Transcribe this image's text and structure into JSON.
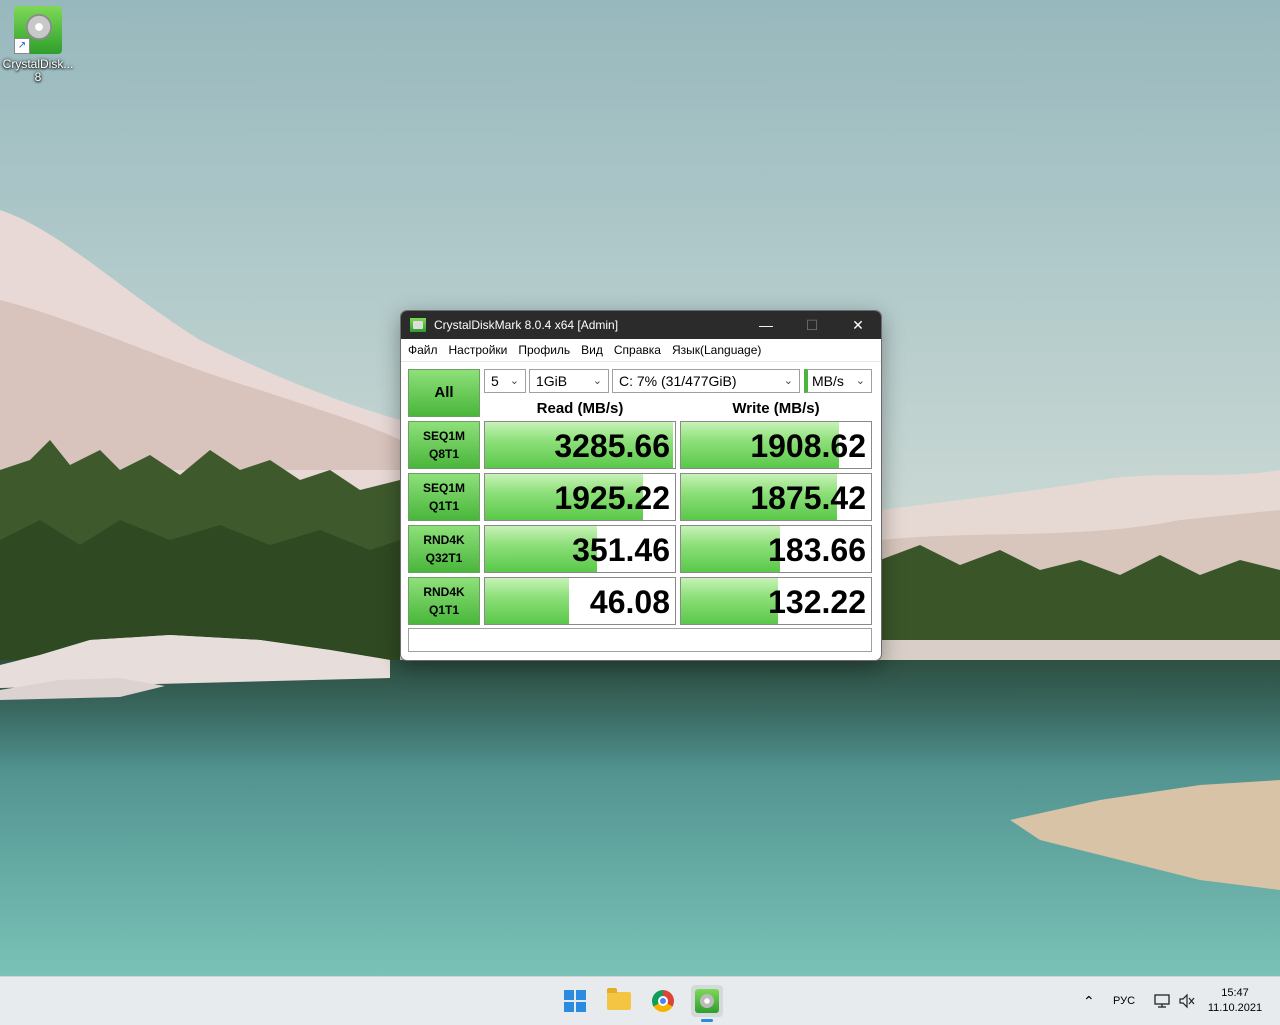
{
  "desktop": {
    "icon_label": "CrystalDisk... 8"
  },
  "window": {
    "title": "CrystalDiskMark 8.0.4 x64 [Admin]",
    "controls": {
      "minimize": "—",
      "maximize": "☐",
      "close": "✕"
    },
    "menu": [
      "Файл",
      "Настройки",
      "Профиль",
      "Вид",
      "Справка",
      "Язык(Language)"
    ],
    "all_button": "All",
    "count_select": "5",
    "size_select": "1GiB",
    "drive_select": "C: 7% (31/477GiB)",
    "unit_select": "MB/s",
    "read_header": "Read (MB/s)",
    "write_header": "Write (MB/s)",
    "tests": [
      {
        "line1": "SEQ1M",
        "line2": "Q8T1",
        "read": "3285.66",
        "write": "1908.62",
        "read_fill": 0.99,
        "write_fill": 0.83
      },
      {
        "line1": "SEQ1M",
        "line2": "Q1T1",
        "read": "1925.22",
        "write": "1875.42",
        "read_fill": 0.83,
        "write_fill": 0.82
      },
      {
        "line1": "RND4K",
        "line2": "Q32T1",
        "read": "351.46",
        "write": "183.66",
        "read_fill": 0.59,
        "write_fill": 0.52
      },
      {
        "line1": "RND4K",
        "line2": "Q1T1",
        "read": "46.08",
        "write": "132.22",
        "read_fill": 0.44,
        "write_fill": 0.51
      }
    ],
    "status": ""
  },
  "taskbar": {
    "language": "РУС",
    "time": "15:47",
    "date": "11.10.2021",
    "icons": [
      "start-icon",
      "file-explorer-icon",
      "chrome-icon",
      "crystaldiskmark-icon"
    ]
  },
  "colors": {
    "bar_green": "#5ac84a",
    "button_green": "#49b63b",
    "titlebar": "#2b2b2b"
  }
}
